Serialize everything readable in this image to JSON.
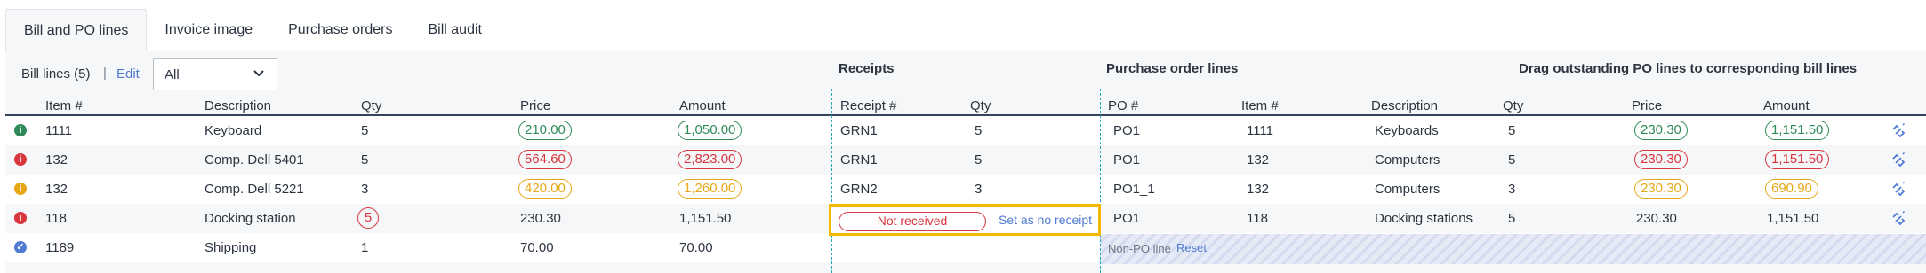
{
  "tabs": [
    {
      "label": "Bill and PO lines",
      "active": true
    },
    {
      "label": "Invoice image",
      "active": false
    },
    {
      "label": "Purchase orders",
      "active": false
    },
    {
      "label": "Bill audit",
      "active": false
    }
  ],
  "toolbar": {
    "bill_lines_label": "Bill lines (5)",
    "separator": "|",
    "edit_label": "Edit",
    "filter_value": "All"
  },
  "sections": {
    "receipts": "Receipts",
    "po_lines": "Purchase order lines",
    "drag_hint": "Drag outstanding PO lines to corresponding bill lines"
  },
  "bill_columns": {
    "item": "Item #",
    "description": "Description",
    "qty": "Qty",
    "price": "Price",
    "amount": "Amount"
  },
  "receipt_columns": {
    "receipt": "Receipt #",
    "qty": "Qty"
  },
  "po_columns": {
    "po": "PO #",
    "item": "Item #",
    "description": "Description",
    "qty": "Qty",
    "price": "Price",
    "amount": "Amount"
  },
  "rows": [
    {
      "status": "info-green",
      "item": "1111",
      "description": "Keyboard",
      "qty": "5",
      "price": "210.00",
      "amount": "1,050.00",
      "receipt": "GRN1",
      "receipt_qty": "5",
      "po": "PO1",
      "po_item": "1111",
      "po_description": "Keyboards",
      "po_qty": "5",
      "po_price": "230.30",
      "po_amount": "1,151.50"
    },
    {
      "status": "info-red",
      "item": "132",
      "description": "Comp. Dell 5401",
      "qty": "5",
      "price": "564.60",
      "amount": "2,823.00",
      "receipt": "GRN1",
      "receipt_qty": "5",
      "po": "PO1",
      "po_item": "132",
      "po_description": "Computers",
      "po_qty": "5",
      "po_price": "230.30",
      "po_amount": "1,151.50"
    },
    {
      "status": "info-yellow",
      "item": "132",
      "description": "Comp. Dell 5221",
      "qty": "3",
      "price": "420.00",
      "amount": "1,260.00",
      "receipt": "GRN2",
      "receipt_qty": "3",
      "po": "PO1_1",
      "po_item": "132",
      "po_description": "Computers",
      "po_qty": "3",
      "po_price": "230.30",
      "po_amount": "690.90"
    },
    {
      "status": "info-red",
      "item": "118",
      "description": "Docking station",
      "qty": "5",
      "price": "230.30",
      "amount": "1,151.50",
      "not_received": "Not received",
      "set_no_receipt": "Set as no receipt",
      "po": "PO1",
      "po_item": "118",
      "po_description": "Docking stations",
      "po_qty": "5",
      "po_price": "230.30",
      "po_amount": "1,151.50"
    },
    {
      "status": "check-blue",
      "item": "1189",
      "description": "Shipping",
      "qty": "1",
      "price": "70.00",
      "amount": "70.00",
      "non_po": "Non-PO line",
      "reset": "Reset"
    }
  ],
  "colors": {
    "green": "#2e8b57",
    "red": "#d9363e",
    "yellow": "#e6a817",
    "blue": "#4f7bd3",
    "highlight": "#f5b800",
    "teal": "#29a3b8"
  }
}
